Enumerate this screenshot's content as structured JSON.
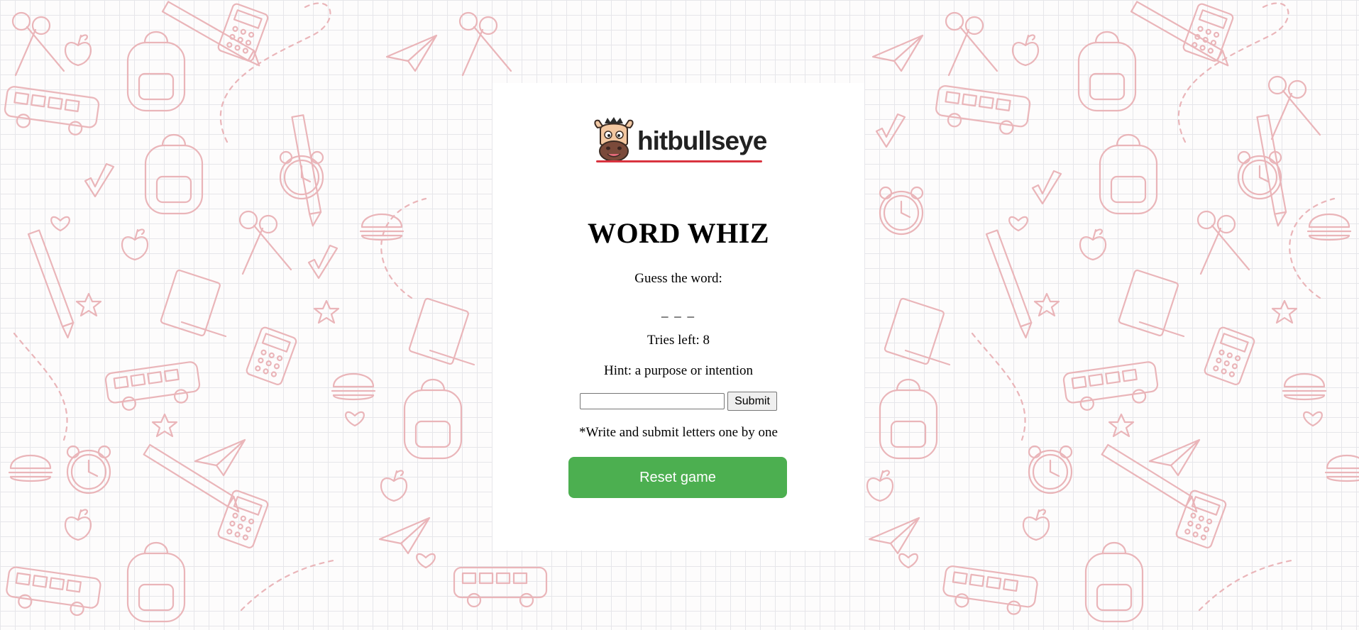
{
  "brand": {
    "name": "hitbullseye",
    "accent_color": "#d9333f"
  },
  "game": {
    "title": "WORD WHIZ",
    "prompt": "Guess the word:",
    "blanks": "_ _ _",
    "tries_left": "Tries left: 8",
    "hint": "Hint: a purpose or intention",
    "input_value": "",
    "submit_label": "Submit",
    "instruction": "*Write and submit letters one by one",
    "reset_label": "Reset game",
    "reset_color": "#4caf50"
  },
  "background": {
    "doodle_color": "#e9b2b6",
    "grid_color": "#e6e6ea"
  }
}
